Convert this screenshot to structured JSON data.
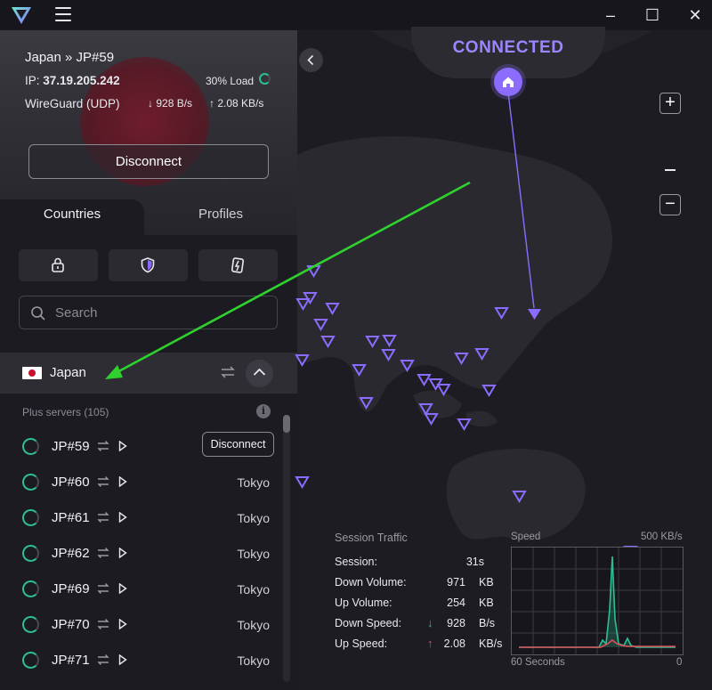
{
  "app": {
    "logo_icon": "proton-vpn-logo-icon",
    "menu_icon": "hamburger-menu-icon"
  },
  "window": {
    "minimize": "–",
    "maximize": "☐",
    "close": "✕"
  },
  "connection": {
    "title": "Japan » JP#59",
    "ip_label": "IP:",
    "ip": "37.19.205.242",
    "load": "30% Load",
    "protocol": "WireGuard (UDP)",
    "down": "928 B/s",
    "up": "2.08 KB/s",
    "disconnect_label": "Disconnect"
  },
  "tabs": {
    "countries": "Countries",
    "profiles": "Profiles"
  },
  "filters": [
    "secure-core-lock-icon",
    "netshield-shield-icon",
    "p2p-icon"
  ],
  "search": {
    "placeholder": "Search"
  },
  "country": {
    "name": "Japan",
    "flag": "japan-flag"
  },
  "plus_servers_label": "Plus servers (105)",
  "servers": [
    {
      "name": "JP#59",
      "city": "",
      "action": "Disconnect"
    },
    {
      "name": "JP#60",
      "city": "Tokyo"
    },
    {
      "name": "JP#61",
      "city": "Tokyo"
    },
    {
      "name": "JP#62",
      "city": "Tokyo"
    },
    {
      "name": "JP#69",
      "city": "Tokyo"
    },
    {
      "name": "JP#70",
      "city": "Tokyo"
    },
    {
      "name": "JP#71",
      "city": "Tokyo"
    }
  ],
  "map": {
    "status": "CONNECTED",
    "accent": "#8b6cff",
    "zoom_in": "+",
    "zoom_out": "−"
  },
  "traffic": {
    "title": "Session Traffic",
    "rows": [
      {
        "label": "Session:",
        "value": "31s",
        "unit": ""
      },
      {
        "label": "Down Volume:",
        "value": "971",
        "unit": "KB"
      },
      {
        "label": "Up Volume:",
        "value": "254",
        "unit": "KB"
      },
      {
        "label": "Down Speed:",
        "value": "928",
        "unit": "B/s",
        "arrow": "↓"
      },
      {
        "label": "Up Speed:",
        "value": "2.08",
        "unit": "KB/s",
        "arrow": "↑"
      }
    ]
  },
  "speed_graph": {
    "title": "Speed",
    "max_label": "500  KB/s",
    "x_start": "60 Seconds",
    "x_end": "0"
  },
  "colors": {
    "down": "#2dbf93",
    "up": "#e0505a",
    "accent": "#8b6cff"
  }
}
